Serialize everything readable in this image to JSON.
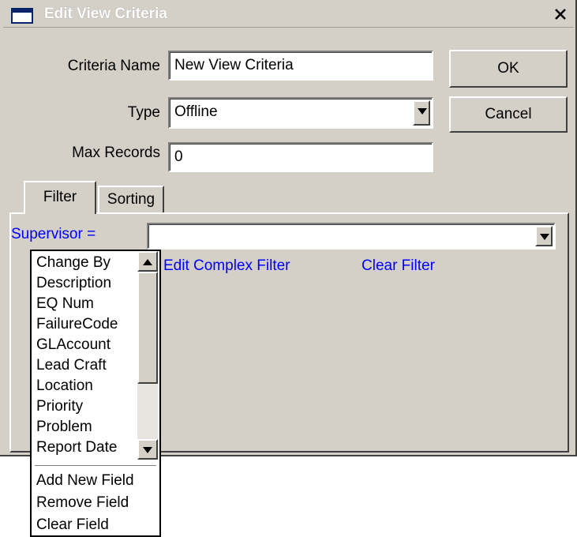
{
  "window": {
    "title": "Edit View Criteria",
    "close_glyph": "✕"
  },
  "form": {
    "criteria_name_label": "Criteria Name",
    "criteria_name_value": "New View Criteria",
    "type_label": "Type",
    "type_value": "Offline",
    "max_records_label": "Max Records",
    "max_records_value": "0"
  },
  "buttons": {
    "ok": "OK",
    "cancel": "Cancel"
  },
  "tabs": [
    {
      "label": "Filter",
      "active": true
    },
    {
      "label": "Sorting",
      "active": false
    }
  ],
  "filter": {
    "field_label": "Supervisor  =",
    "field_value": "",
    "edit_complex_label": "Edit Complex Filter",
    "clear_filter_label": "Clear Filter",
    "link_color": "#0000ff"
  },
  "field_list": {
    "items": [
      "Change By",
      "Description",
      "EQ Num",
      "FailureCode",
      "GLAccount",
      "Lead Craft",
      "Location",
      "Priority",
      "Problem",
      "Report Date"
    ],
    "actions": [
      "Add New Field",
      "Remove Field",
      "Clear Field"
    ]
  },
  "icons": {
    "dropdown": "chevron-down-icon",
    "scroll_up": "arrow-up-icon",
    "scroll_down": "arrow-down-icon"
  }
}
